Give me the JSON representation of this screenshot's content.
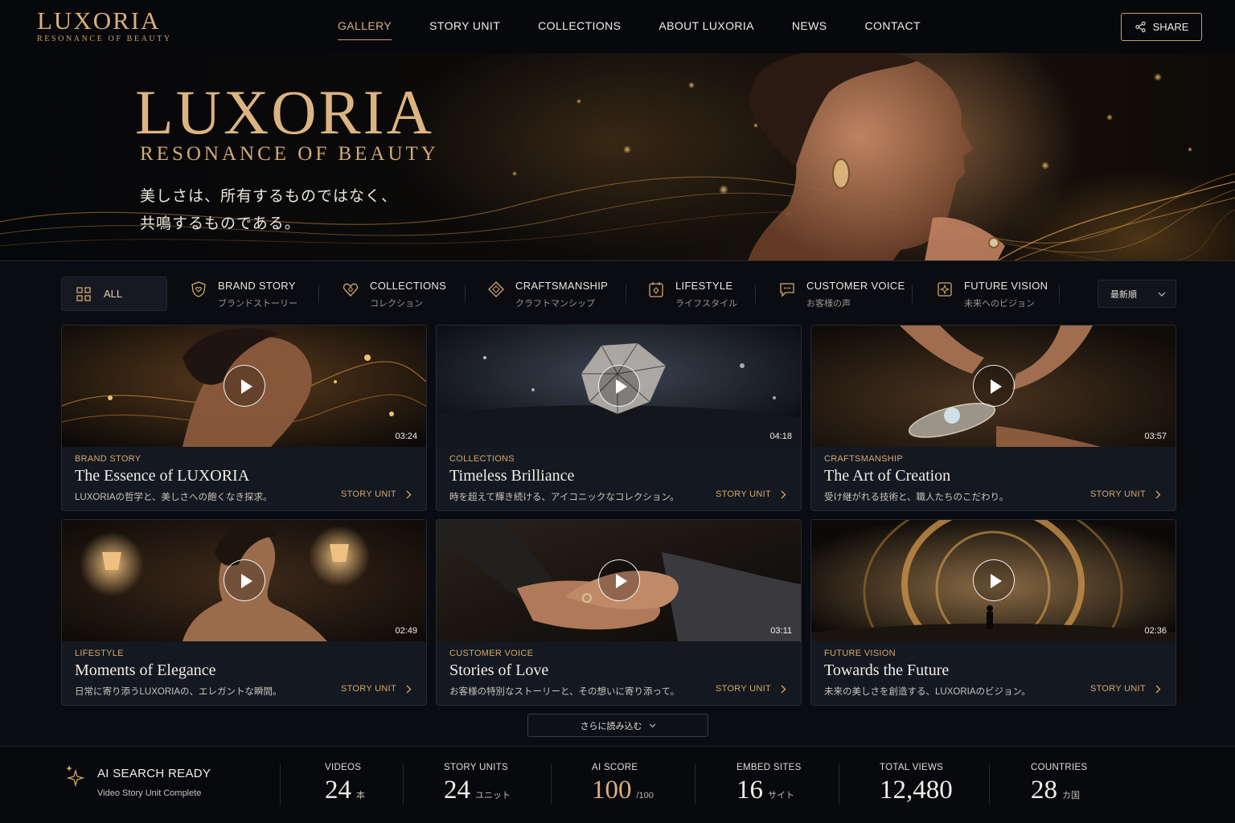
{
  "brand": {
    "name": "LUXORIA",
    "tagline": "RESONANCE OF BEAUTY"
  },
  "nav": {
    "items": [
      {
        "label": "GALLERY",
        "active": true
      },
      {
        "label": "STORY UNIT",
        "active": false
      },
      {
        "label": "COLLECTIONS",
        "active": false
      },
      {
        "label": "ABOUT LUXORIA",
        "active": false
      },
      {
        "label": "NEWS",
        "active": false
      },
      {
        "label": "CONTACT",
        "active": false
      }
    ],
    "share_label": "SHARE"
  },
  "hero": {
    "title": "LUXORIA",
    "subtitle": "RESONANCE OF BEAUTY",
    "tagline_line1": "美しさは、所有するものではなく、",
    "tagline_line2": "共鳴するものである。"
  },
  "filters": {
    "all_label": "ALL",
    "items": [
      {
        "en": "BRAND STORY",
        "jp": "ブランドストーリー",
        "icon": "shield-heart-icon"
      },
      {
        "en": "COLLECTIONS",
        "jp": "コレクション",
        "icon": "heart-icon"
      },
      {
        "en": "CRAFTSMANSHIP",
        "jp": "クラフトマンシップ",
        "icon": "diamond-icon"
      },
      {
        "en": "LIFESTYLE",
        "jp": "ライフスタイル",
        "icon": "gem-box-icon"
      },
      {
        "en": "CUSTOMER VOICE",
        "jp": "お客様の声",
        "icon": "chat-icon"
      },
      {
        "en": "FUTURE VISION",
        "jp": "未来へのビジョン",
        "icon": "sparkle-box-icon"
      }
    ],
    "sort_label": "最新順"
  },
  "cards": [
    {
      "category": "BRAND STORY",
      "title": "The Essence of LUXORIA",
      "desc": "LUXORIAの哲学と、美しさへの飽くなき探求。",
      "duration": "03:24",
      "link": "STORY UNIT"
    },
    {
      "category": "COLLECTIONS",
      "title": "Timeless Brilliance",
      "desc": "時を超えて輝き続ける、アイコニックなコレクション。",
      "duration": "04:18",
      "link": "STORY UNIT"
    },
    {
      "category": "CRAFTSMANSHIP",
      "title": "The Art of Creation",
      "desc": "受け継がれる技術と、職人たちのこだわり。",
      "duration": "03:57",
      "link": "STORY UNIT"
    },
    {
      "category": "LIFESTYLE",
      "title": "Moments of Elegance",
      "desc": "日常に寄り添うLUXORIAの、エレガントな瞬間。",
      "duration": "02:49",
      "link": "STORY UNIT"
    },
    {
      "category": "CUSTOMER VOICE",
      "title": "Stories of Love",
      "desc": "お客様の特別なストーリーと、その想いに寄り添って。",
      "duration": "03:11",
      "link": "STORY UNIT"
    },
    {
      "category": "FUTURE VISION",
      "title": "Towards the Future",
      "desc": "未来の美しさを創造する、LUXORIAのビジョン。",
      "duration": "02:36",
      "link": "STORY UNIT"
    }
  ],
  "load_more": "さらに読み込む",
  "stats": {
    "ai_title": "AI SEARCH READY",
    "ai_sub": "Video Story Unit Complete",
    "items": [
      {
        "label": "VIDEOS",
        "value": "24",
        "unit": "本"
      },
      {
        "label": "STORY UNITS",
        "value": "24",
        "unit": "ユニット"
      },
      {
        "label": "AI SCORE",
        "value": "100",
        "unit": "/100"
      },
      {
        "label": "EMBED SITES",
        "value": "16",
        "unit": "サイト"
      },
      {
        "label": "TOTAL VIEWS",
        "value": "12,480",
        "unit": ""
      },
      {
        "label": "COUNTRIES",
        "value": "28",
        "unit": "カ国"
      }
    ]
  },
  "colors": {
    "accent": "#d4a96a",
    "background": "#0a0c11",
    "card": "#141820"
  }
}
